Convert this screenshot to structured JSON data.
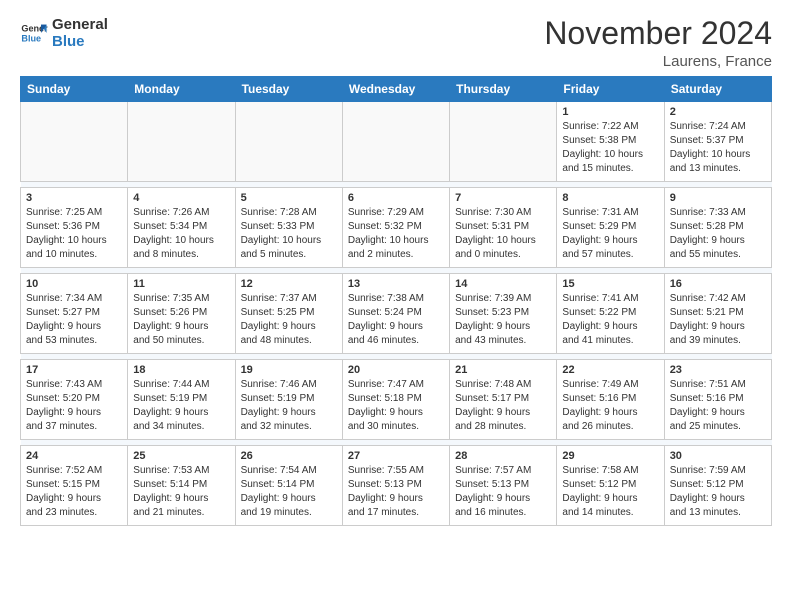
{
  "header": {
    "logo_line1": "General",
    "logo_line2": "Blue",
    "month": "November 2024",
    "location": "Laurens, France"
  },
  "weekdays": [
    "Sunday",
    "Monday",
    "Tuesday",
    "Wednesday",
    "Thursday",
    "Friday",
    "Saturday"
  ],
  "weeks": [
    [
      {
        "day": "",
        "info": ""
      },
      {
        "day": "",
        "info": ""
      },
      {
        "day": "",
        "info": ""
      },
      {
        "day": "",
        "info": ""
      },
      {
        "day": "",
        "info": ""
      },
      {
        "day": "1",
        "info": "Sunrise: 7:22 AM\nSunset: 5:38 PM\nDaylight: 10 hours\nand 15 minutes."
      },
      {
        "day": "2",
        "info": "Sunrise: 7:24 AM\nSunset: 5:37 PM\nDaylight: 10 hours\nand 13 minutes."
      }
    ],
    [
      {
        "day": "3",
        "info": "Sunrise: 7:25 AM\nSunset: 5:36 PM\nDaylight: 10 hours\nand 10 minutes."
      },
      {
        "day": "4",
        "info": "Sunrise: 7:26 AM\nSunset: 5:34 PM\nDaylight: 10 hours\nand 8 minutes."
      },
      {
        "day": "5",
        "info": "Sunrise: 7:28 AM\nSunset: 5:33 PM\nDaylight: 10 hours\nand 5 minutes."
      },
      {
        "day": "6",
        "info": "Sunrise: 7:29 AM\nSunset: 5:32 PM\nDaylight: 10 hours\nand 2 minutes."
      },
      {
        "day": "7",
        "info": "Sunrise: 7:30 AM\nSunset: 5:31 PM\nDaylight: 10 hours\nand 0 minutes."
      },
      {
        "day": "8",
        "info": "Sunrise: 7:31 AM\nSunset: 5:29 PM\nDaylight: 9 hours\nand 57 minutes."
      },
      {
        "day": "9",
        "info": "Sunrise: 7:33 AM\nSunset: 5:28 PM\nDaylight: 9 hours\nand 55 minutes."
      }
    ],
    [
      {
        "day": "10",
        "info": "Sunrise: 7:34 AM\nSunset: 5:27 PM\nDaylight: 9 hours\nand 53 minutes."
      },
      {
        "day": "11",
        "info": "Sunrise: 7:35 AM\nSunset: 5:26 PM\nDaylight: 9 hours\nand 50 minutes."
      },
      {
        "day": "12",
        "info": "Sunrise: 7:37 AM\nSunset: 5:25 PM\nDaylight: 9 hours\nand 48 minutes."
      },
      {
        "day": "13",
        "info": "Sunrise: 7:38 AM\nSunset: 5:24 PM\nDaylight: 9 hours\nand 46 minutes."
      },
      {
        "day": "14",
        "info": "Sunrise: 7:39 AM\nSunset: 5:23 PM\nDaylight: 9 hours\nand 43 minutes."
      },
      {
        "day": "15",
        "info": "Sunrise: 7:41 AM\nSunset: 5:22 PM\nDaylight: 9 hours\nand 41 minutes."
      },
      {
        "day": "16",
        "info": "Sunrise: 7:42 AM\nSunset: 5:21 PM\nDaylight: 9 hours\nand 39 minutes."
      }
    ],
    [
      {
        "day": "17",
        "info": "Sunrise: 7:43 AM\nSunset: 5:20 PM\nDaylight: 9 hours\nand 37 minutes."
      },
      {
        "day": "18",
        "info": "Sunrise: 7:44 AM\nSunset: 5:19 PM\nDaylight: 9 hours\nand 34 minutes."
      },
      {
        "day": "19",
        "info": "Sunrise: 7:46 AM\nSunset: 5:19 PM\nDaylight: 9 hours\nand 32 minutes."
      },
      {
        "day": "20",
        "info": "Sunrise: 7:47 AM\nSunset: 5:18 PM\nDaylight: 9 hours\nand 30 minutes."
      },
      {
        "day": "21",
        "info": "Sunrise: 7:48 AM\nSunset: 5:17 PM\nDaylight: 9 hours\nand 28 minutes."
      },
      {
        "day": "22",
        "info": "Sunrise: 7:49 AM\nSunset: 5:16 PM\nDaylight: 9 hours\nand 26 minutes."
      },
      {
        "day": "23",
        "info": "Sunrise: 7:51 AM\nSunset: 5:16 PM\nDaylight: 9 hours\nand 25 minutes."
      }
    ],
    [
      {
        "day": "24",
        "info": "Sunrise: 7:52 AM\nSunset: 5:15 PM\nDaylight: 9 hours\nand 23 minutes."
      },
      {
        "day": "25",
        "info": "Sunrise: 7:53 AM\nSunset: 5:14 PM\nDaylight: 9 hours\nand 21 minutes."
      },
      {
        "day": "26",
        "info": "Sunrise: 7:54 AM\nSunset: 5:14 PM\nDaylight: 9 hours\nand 19 minutes."
      },
      {
        "day": "27",
        "info": "Sunrise: 7:55 AM\nSunset: 5:13 PM\nDaylight: 9 hours\nand 17 minutes."
      },
      {
        "day": "28",
        "info": "Sunrise: 7:57 AM\nSunset: 5:13 PM\nDaylight: 9 hours\nand 16 minutes."
      },
      {
        "day": "29",
        "info": "Sunrise: 7:58 AM\nSunset: 5:12 PM\nDaylight: 9 hours\nand 14 minutes."
      },
      {
        "day": "30",
        "info": "Sunrise: 7:59 AM\nSunset: 5:12 PM\nDaylight: 9 hours\nand 13 minutes."
      }
    ]
  ]
}
